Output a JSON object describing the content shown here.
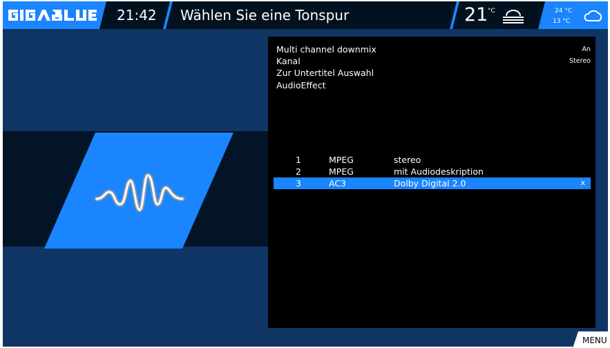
{
  "header": {
    "brand": "GIGABLUE",
    "clock": "21:42",
    "title": "Wählen Sie eine Tonspur",
    "weather": {
      "current_temp": "21",
      "temp_unit": "°C",
      "current_icon": "fog-icon",
      "forecast_high": "24 °C",
      "forecast_low": "13 °C",
      "forecast_icon": "cloud-icon"
    }
  },
  "artwork": {
    "icon": "audio-wave-icon"
  },
  "settings": [
    {
      "label": "Multi channel downmix",
      "value": "An"
    },
    {
      "label": "Kanal",
      "value": "Stereo"
    },
    {
      "label": "Zur Untertitel Auswahl",
      "value": ""
    },
    {
      "label": "AudioEffect",
      "value": ""
    }
  ],
  "tracks": [
    {
      "num": "1",
      "codec": "MPEG",
      "desc": "stereo",
      "mark": "",
      "selected": false
    },
    {
      "num": "2",
      "codec": "MPEG",
      "desc": "mit Audiodeskription",
      "mark": "",
      "selected": false
    },
    {
      "num": "3",
      "codec": "AC3",
      "desc": "Dolby Digital 2.0",
      "mark": "x",
      "selected": true
    }
  ],
  "footer": {
    "menu_label": "MENU"
  },
  "colors": {
    "accent": "#1a85ff",
    "background": "#0f3564",
    "panel": "#000000",
    "topbar": "#02111f"
  }
}
